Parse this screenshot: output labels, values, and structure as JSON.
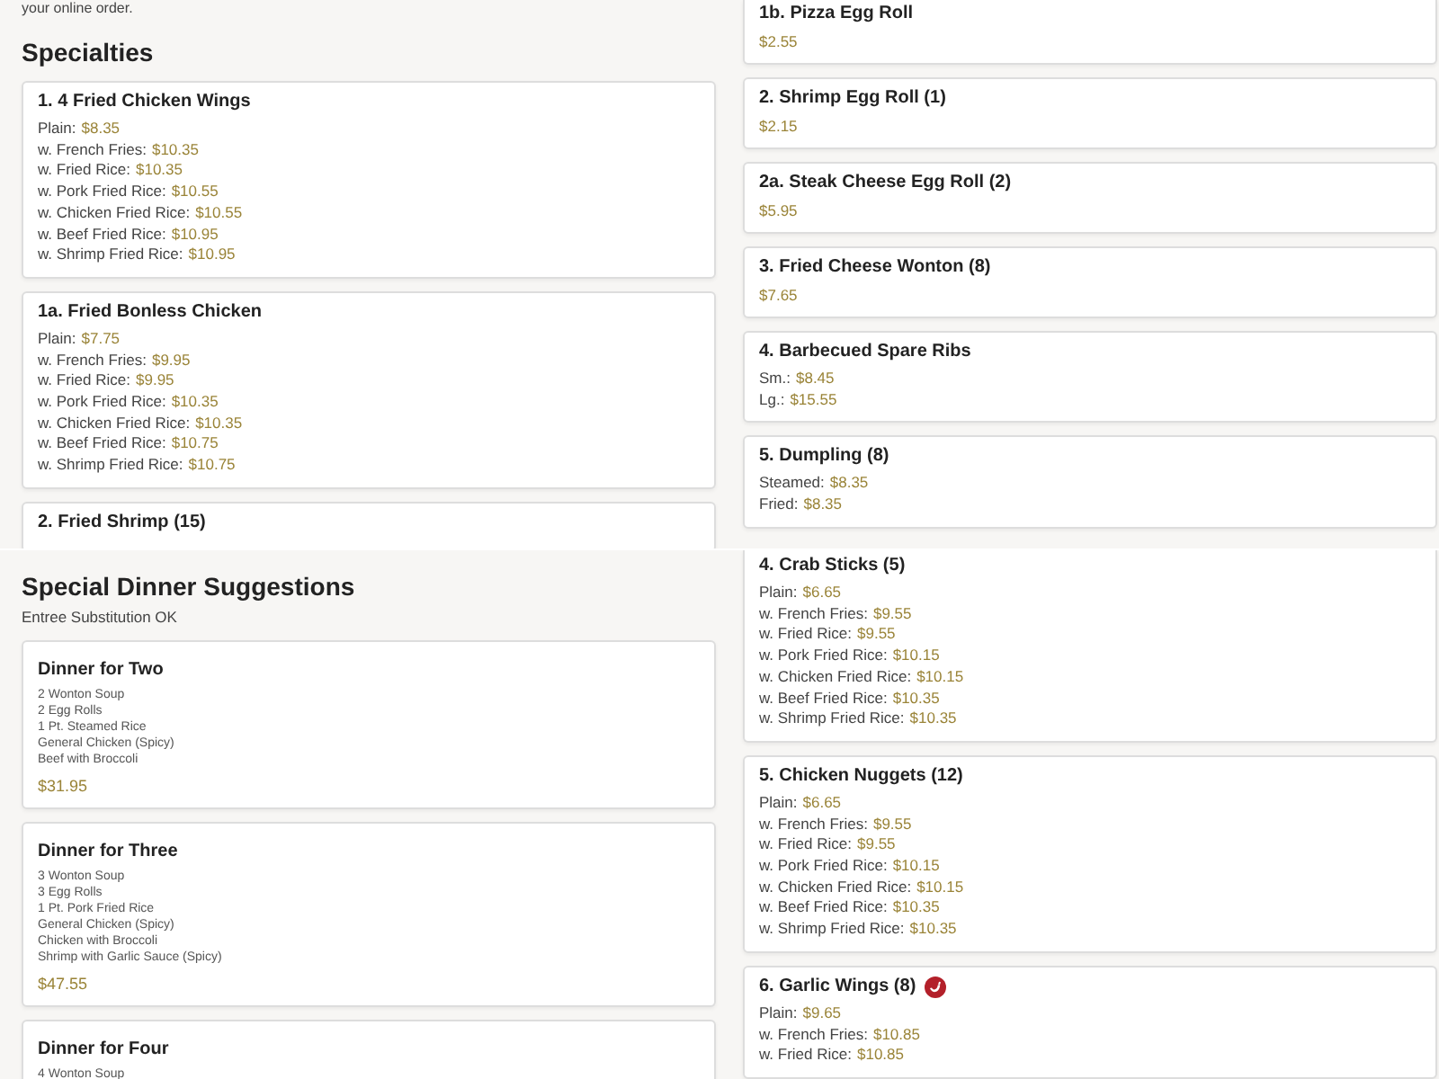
{
  "left_top": {
    "intro": "your online order.",
    "heading": "Specialties",
    "items": [
      {
        "name": "1. 4 Fried Chicken Wings",
        "spicy": false,
        "options": [
          {
            "label": "Plain:",
            "price": "$8.35"
          },
          {
            "label": "w. French Fries:",
            "price": "$10.35"
          },
          {
            "label": "w. Fried Rice:",
            "price": "$10.35"
          },
          {
            "label": "w. Pork Fried Rice:",
            "price": "$10.55"
          },
          {
            "label": "w. Chicken Fried Rice:",
            "price": "$10.55"
          },
          {
            "label": "w. Beef Fried Rice:",
            "price": "$10.95"
          },
          {
            "label": "w. Shrimp Fried Rice:",
            "price": "$10.95"
          }
        ]
      },
      {
        "name": "1a. Fried Bonless Chicken",
        "spicy": false,
        "options": [
          {
            "label": "Plain:",
            "price": "$7.75"
          },
          {
            "label": "w. French Fries:",
            "price": "$9.95"
          },
          {
            "label": "w. Fried Rice:",
            "price": "$9.95"
          },
          {
            "label": "w. Pork Fried Rice:",
            "price": "$10.35"
          },
          {
            "label": "w. Chicken Fried Rice:",
            "price": "$10.35"
          },
          {
            "label": "w. Beef Fried Rice:",
            "price": "$10.75"
          },
          {
            "label": "w. Shrimp Fried Rice:",
            "price": "$10.75"
          }
        ]
      },
      {
        "name": "2. Fried Shrimp (15)",
        "spicy": false
      }
    ]
  },
  "left_bottom": {
    "heading": "Special Dinner Suggestions",
    "note": "Entree Substitution OK",
    "dinners": [
      {
        "name": "Dinner for Two",
        "contents": [
          "2 Wonton Soup",
          "2 Egg Rolls",
          "1 Pt. Steamed Rice",
          "General Chicken (Spicy)",
          "Beef with Broccoli"
        ],
        "price": "$31.95"
      },
      {
        "name": "Dinner for Three",
        "contents": [
          "3 Wonton Soup",
          "3 Egg Rolls",
          "1 Pt. Pork Fried Rice",
          "General Chicken (Spicy)",
          "Chicken with Broccoli",
          "Shrimp with Garlic Sauce (Spicy)"
        ],
        "price": "$47.55"
      },
      {
        "name": "Dinner for Four",
        "contents": [
          "4 Wonton Soup"
        ]
      }
    ]
  },
  "right_top": {
    "items": [
      {
        "name": "1b. Pizza Egg Roll",
        "spicy": false,
        "price": "$2.55"
      },
      {
        "name": "2. Shrimp Egg Roll (1)",
        "spicy": false,
        "price": "$2.15"
      },
      {
        "name": "2a. Steak Cheese Egg Roll (2)",
        "spicy": false,
        "price": "$5.95"
      },
      {
        "name": "3. Fried Cheese Wonton (8)",
        "spicy": false,
        "price": "$7.65"
      },
      {
        "name": "4. Barbecued Spare Ribs",
        "spicy": false,
        "options": [
          {
            "label": "Sm.:",
            "price": "$8.45"
          },
          {
            "label": "Lg.:",
            "price": "$15.55"
          }
        ]
      },
      {
        "name": "5. Dumpling (8)",
        "spicy": false,
        "options": [
          {
            "label": "Steamed:",
            "price": "$8.35"
          },
          {
            "label": "Fried:",
            "price": "$8.35"
          }
        ]
      }
    ]
  },
  "right_bottom": {
    "items": [
      {
        "name": "4. Crab Sticks (5)",
        "spicy": false,
        "options": [
          {
            "label": "Plain:",
            "price": "$6.65"
          },
          {
            "label": "w. French Fries:",
            "price": "$9.55"
          },
          {
            "label": "w. Fried Rice:",
            "price": "$9.55"
          },
          {
            "label": "w. Pork Fried Rice:",
            "price": "$10.15"
          },
          {
            "label": "w. Chicken Fried Rice:",
            "price": "$10.15"
          },
          {
            "label": "w. Beef Fried Rice:",
            "price": "$10.35"
          },
          {
            "label": "w. Shrimp Fried Rice:",
            "price": "$10.35"
          }
        ]
      },
      {
        "name": "5. Chicken Nuggets (12)",
        "spicy": false,
        "options": [
          {
            "label": "Plain:",
            "price": "$6.65"
          },
          {
            "label": "w. French Fries:",
            "price": "$9.55"
          },
          {
            "label": "w. Fried Rice:",
            "price": "$9.55"
          },
          {
            "label": "w. Pork Fried Rice:",
            "price": "$10.15"
          },
          {
            "label": "w. Chicken Fried Rice:",
            "price": "$10.15"
          },
          {
            "label": "w. Beef Fried Rice:",
            "price": "$10.35"
          },
          {
            "label": "w. Shrimp Fried Rice:",
            "price": "$10.35"
          }
        ]
      },
      {
        "name": "6. Garlic Wings (8)",
        "spicy": true,
        "options": [
          {
            "label": "Plain:",
            "price": "$9.65"
          },
          {
            "label": "w. French Fries:",
            "price": "$10.85"
          },
          {
            "label": "w. Fried Rice:",
            "price": "$10.85"
          }
        ]
      }
    ]
  }
}
